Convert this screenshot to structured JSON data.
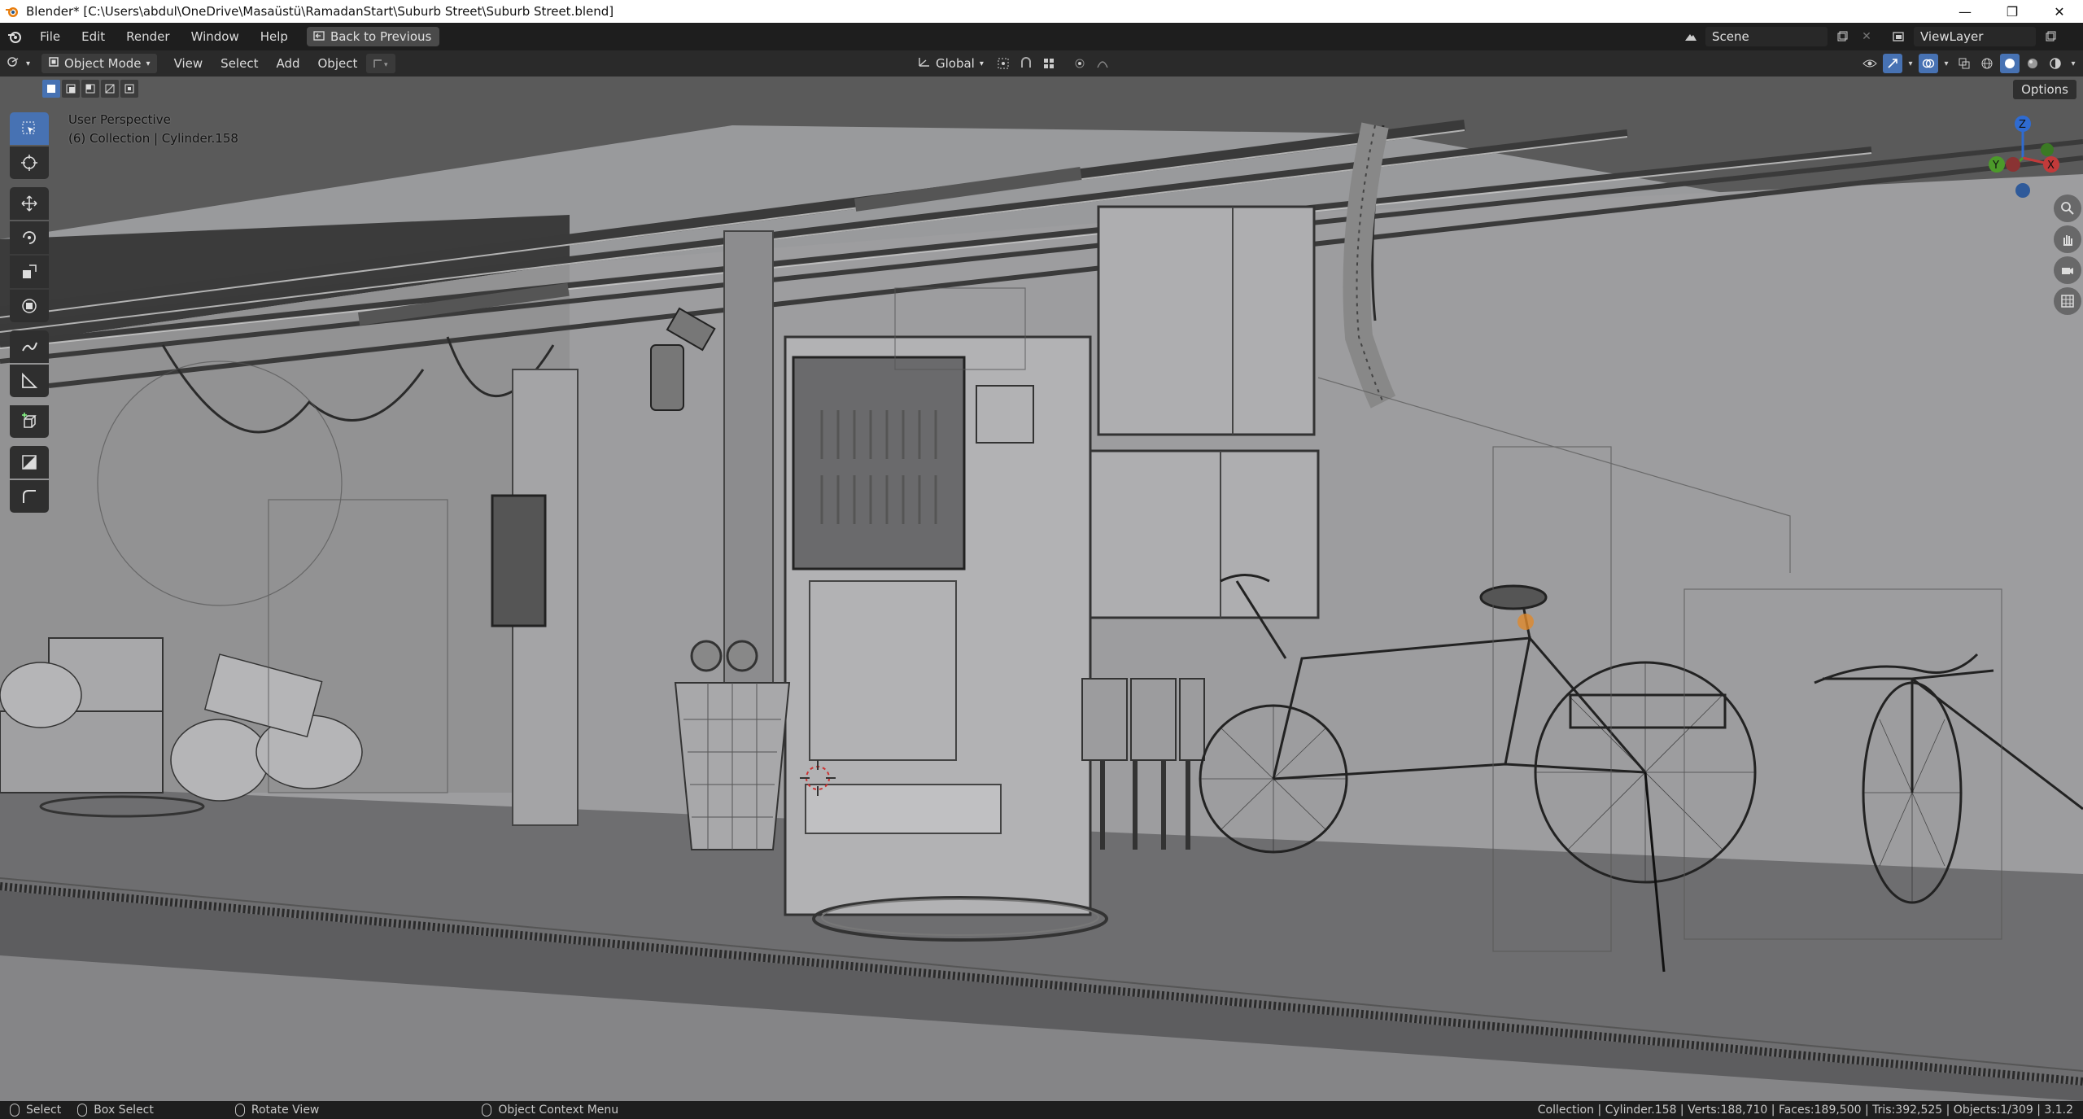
{
  "window": {
    "title": "Blender* [C:\\Users\\abdul\\OneDrive\\Masaüstü\\RamadanStart\\Suburb Street\\Suburb Street.blend]",
    "minimize": "—",
    "maximize": "❐",
    "close": "✕"
  },
  "menubar": {
    "items": [
      "File",
      "Edit",
      "Render",
      "Window",
      "Help"
    ],
    "back_button": "Back to Previous",
    "scene_label": "Scene",
    "view_layer_label": "ViewLayer"
  },
  "viewport_header": {
    "mode": "Object Mode",
    "menus": [
      "View",
      "Select",
      "Add",
      "Object"
    ],
    "transform_orientation": "Global"
  },
  "viewport": {
    "perspective": "User Perspective",
    "collection_info": "(6) Collection | Cylinder.158",
    "options_label": "Options",
    "gizmo": {
      "z": "Z",
      "y": "Y",
      "x": "X"
    }
  },
  "statusbar": {
    "select": "Select",
    "box_select": "Box Select",
    "rotate_view": "Rotate View",
    "context_menu": "Object Context Menu",
    "stats": "Collection | Cylinder.158 | Verts:188,710 | Faces:189,500 | Tris:392,525 | Objects:1/309 | 3.1.2"
  },
  "colors": {
    "accent": "#4772b3",
    "viewport_bg": "#9a9a9a",
    "header_bg": "#2a2a2a",
    "menubar_bg": "#1e1e1e"
  }
}
